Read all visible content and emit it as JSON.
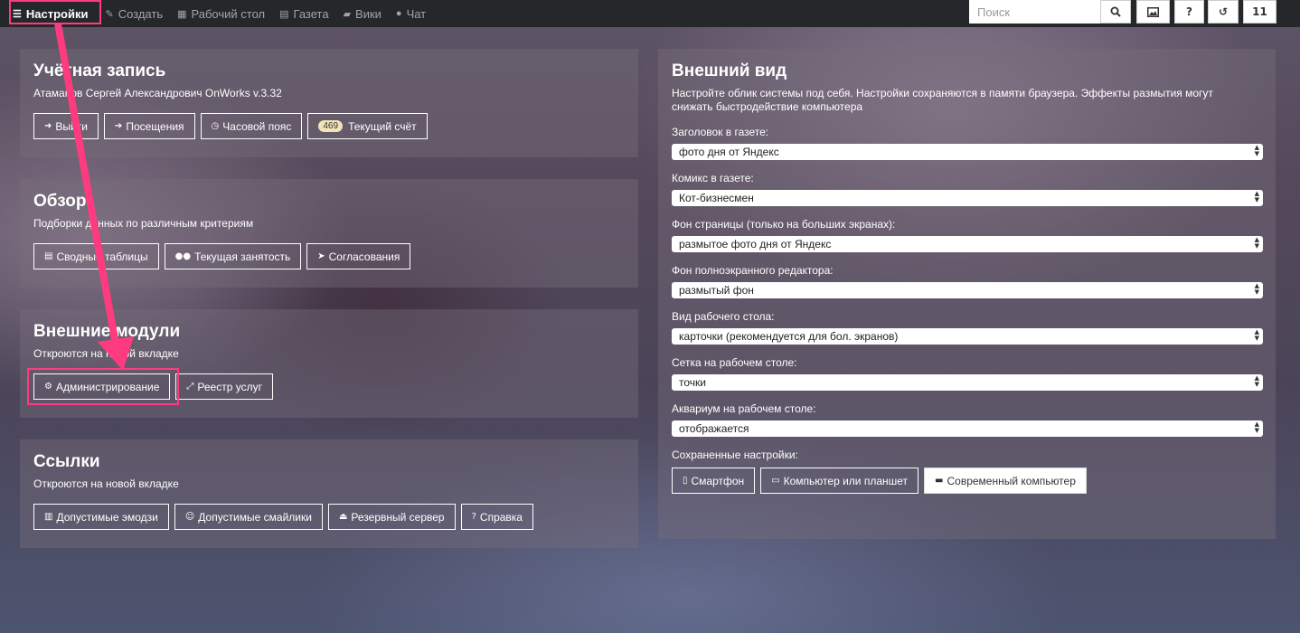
{
  "nav": {
    "settings": "Настройки",
    "create": "Создать",
    "desktop": "Рабочий стол",
    "newspaper": "Газета",
    "wiki": "Вики",
    "chat": "Чат",
    "search_placeholder": "Поиск",
    "help": "?",
    "count": "11"
  },
  "account": {
    "title": "Учётная запись",
    "user": "Атаманов Сергей Александрович OnWorks v.3.32",
    "buttons": {
      "logout": "Выйти",
      "visits": "Посещения",
      "timezone": "Часовой пояс",
      "balance_badge": "469",
      "balance": "Текущий счёт"
    }
  },
  "overview": {
    "title": "Обзор",
    "subtitle": "Подборки данных по различным критериям",
    "buttons": {
      "pivot": "Сводные таблицы",
      "workload": "Текущая занятость",
      "approvals": "Согласования"
    }
  },
  "external": {
    "title": "Внешние модули",
    "subtitle": "Откроются на новой вкладке",
    "buttons": {
      "admin": "Администрирование",
      "registry": "Реестр услуг"
    }
  },
  "links": {
    "title": "Ссылки",
    "subtitle": "Откроются на новой вкладке",
    "buttons": {
      "emoji": "Допустимые эмодзи",
      "smileys": "Допустимые смайлики",
      "backup": "Резервный сервер",
      "help": "Справка"
    }
  },
  "appearance": {
    "title": "Внешний вид",
    "description": "Настройте облик системы под себя. Настройки сохраняются в памяти браузера. Эффекты размытия могут снижать быстродействие компьютера",
    "fields": [
      {
        "label": "Заголовок в газете:",
        "value": "фото дня от Яндекс"
      },
      {
        "label": "Комикс в газете:",
        "value": "Кот-бизнесмен"
      },
      {
        "label": "Фон страницы (только на больших экранах):",
        "value": "размытое фото дня от Яндекс"
      },
      {
        "label": "Фон полноэкранного редактора:",
        "value": "размытый фон"
      },
      {
        "label": "Вид рабочего стола:",
        "value": "карточки (рекомендуется для бол. экранов)"
      },
      {
        "label": "Сетка на рабочем столе:",
        "value": "точки"
      },
      {
        "label": "Аквариум на рабочем столе:",
        "value": "отображается"
      }
    ],
    "saved_label": "Сохраненные настройки:",
    "presets": {
      "phone": "Смартфон",
      "tablet": "Компьютер или планшет",
      "desktop": "Современный компьютер"
    }
  },
  "colors": {
    "navbar": "#26272b",
    "annotation": "#ff3b7f"
  }
}
